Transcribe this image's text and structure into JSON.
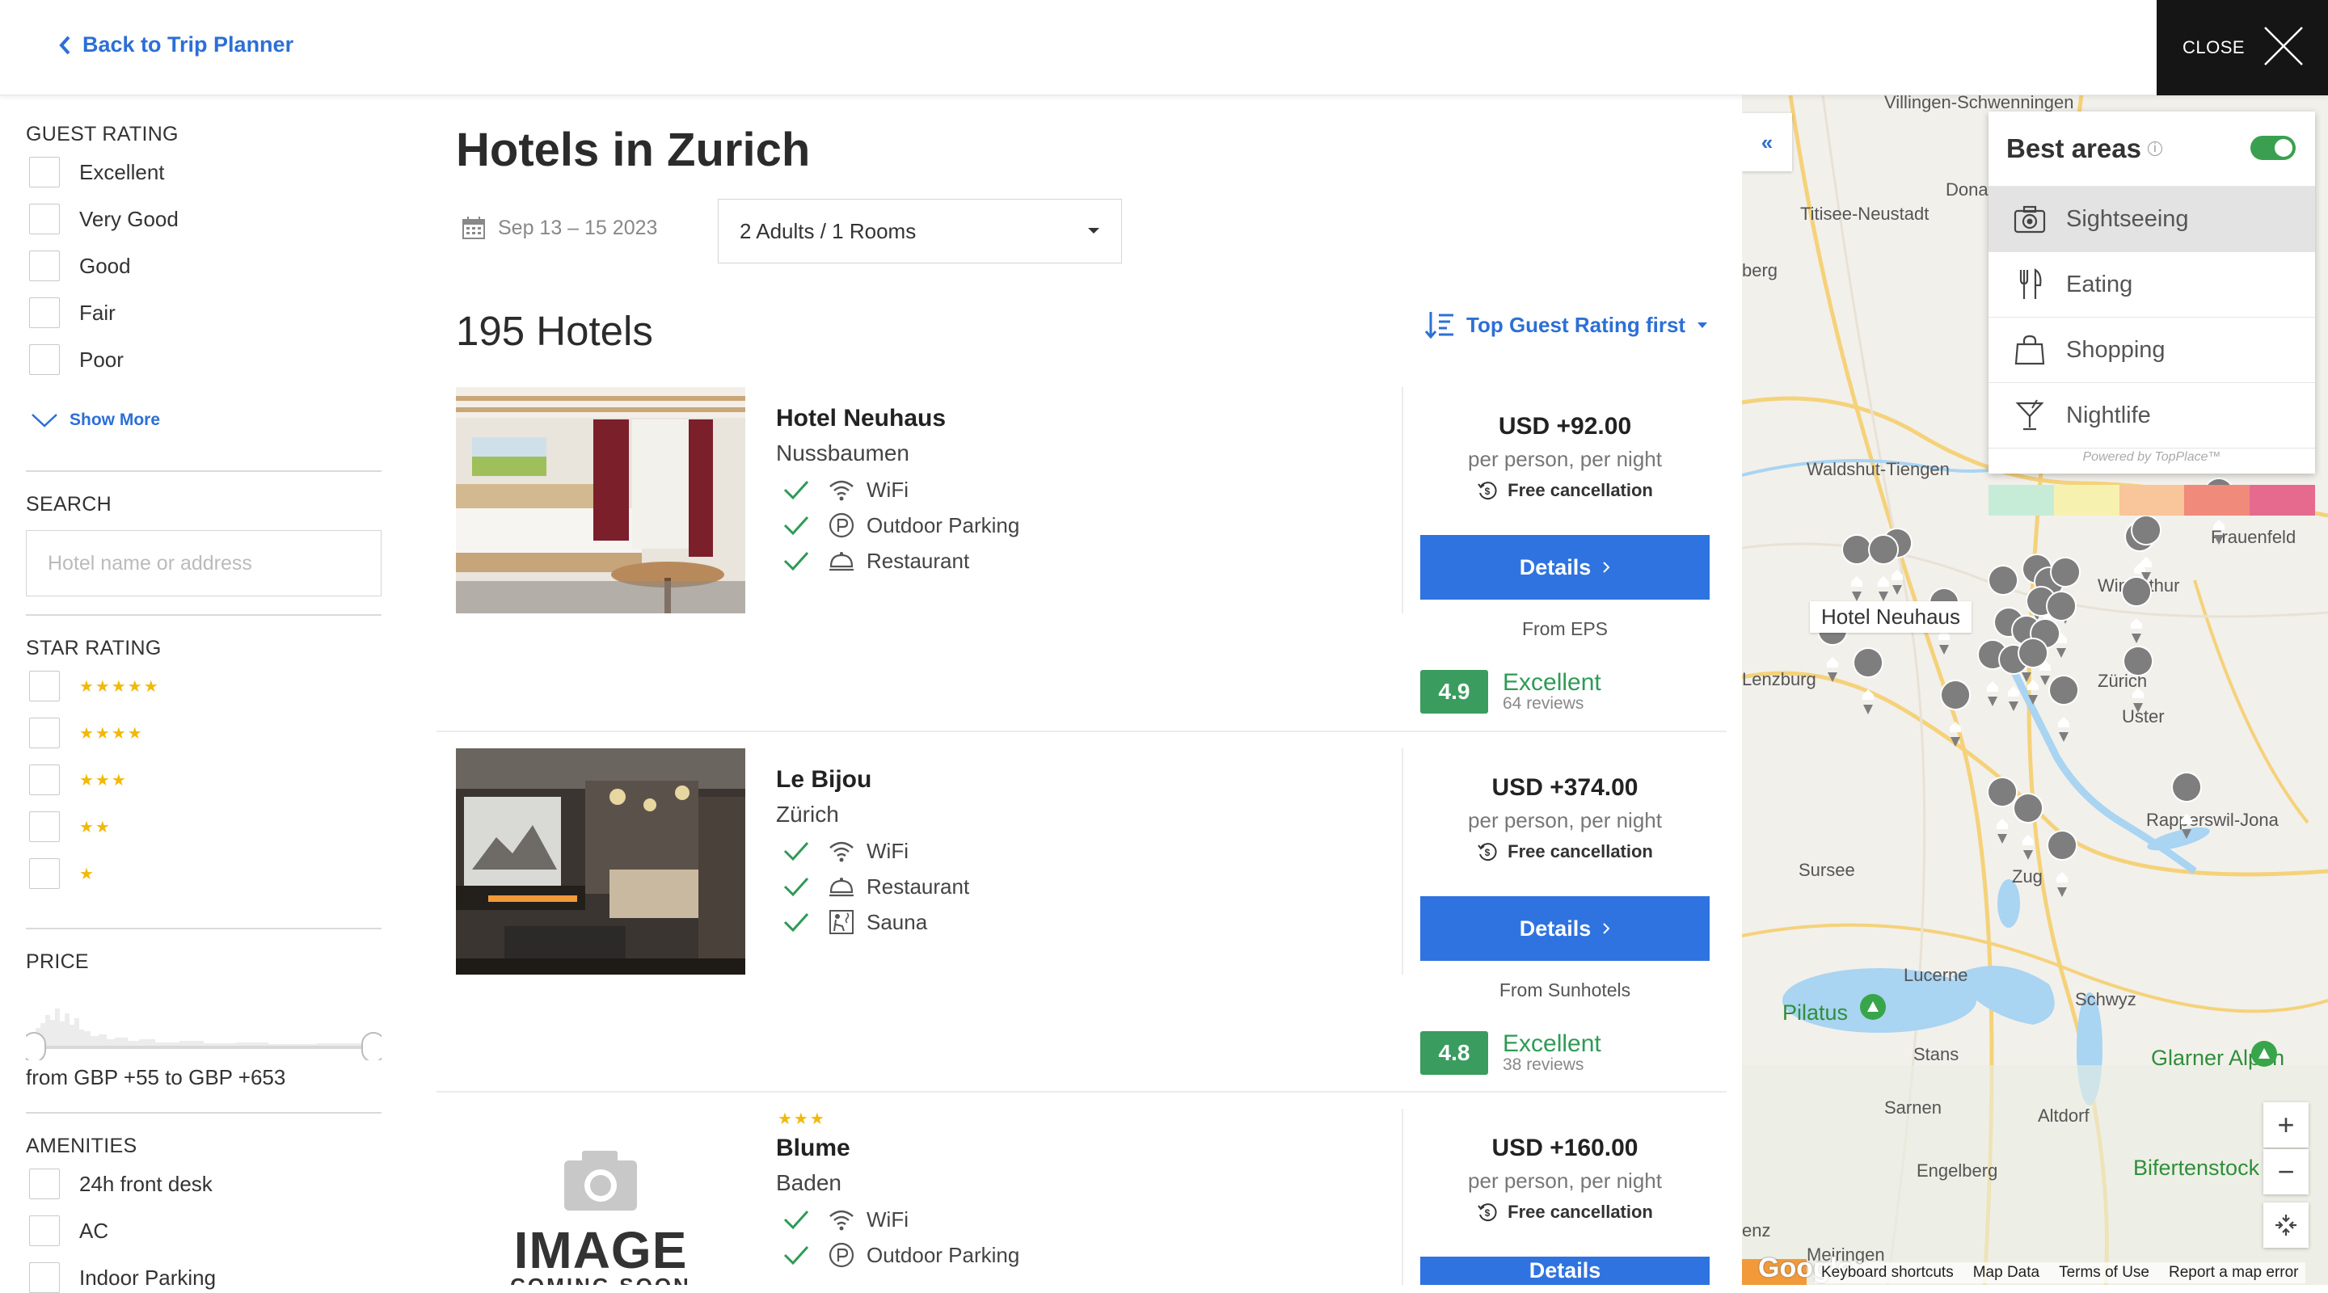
{
  "topbar": {
    "back_label": "Back to Trip Planner",
    "close_label": "CLOSE"
  },
  "filters": {
    "guest_rating": {
      "title": "GUEST RATING",
      "options": [
        "Excellent",
        "Very Good",
        "Good",
        "Fair",
        "Poor"
      ],
      "show_more": "Show More"
    },
    "search": {
      "title": "SEARCH",
      "placeholder": "Hotel name or address"
    },
    "star_rating": {
      "title": "STAR RATING",
      "options": [
        "★★★★★",
        "★★★★",
        "★★★",
        "★★",
        "★"
      ]
    },
    "price": {
      "title": "PRICE",
      "range_text": "from GBP +55 to GBP +653"
    },
    "amenities": {
      "title": "AMENITIES",
      "options": [
        "24h front desk",
        "AC",
        "Indoor Parking"
      ]
    }
  },
  "main": {
    "title": "Hotels in Zurich",
    "dates": "Sep 13 – 15 2023",
    "guests": "2 Adults / 1 Rooms",
    "count": "195 Hotels",
    "sort_label": "Top Guest Rating first"
  },
  "hotels": [
    {
      "name": "Hotel Neuhaus",
      "city": "Nussbaumen",
      "amenities": [
        "WiFi",
        "Outdoor Parking",
        "Restaurant"
      ],
      "price": "USD +92.00",
      "per": "per person, per night",
      "cancel": "Free cancellation",
      "details": "Details",
      "from": "From EPS",
      "score": "4.9",
      "score_word": "Excellent",
      "reviews": "64 reviews"
    },
    {
      "name": "Le Bijou",
      "city": "Zürich",
      "amenities": [
        "WiFi",
        "Restaurant",
        "Sauna"
      ],
      "price": "USD +374.00",
      "per": "per person, per night",
      "cancel": "Free cancellation",
      "details": "Details",
      "from": "From Sunhotels",
      "score": "4.8",
      "score_word": "Excellent",
      "reviews": "38 reviews"
    },
    {
      "name": "Blume",
      "city": "Baden",
      "stars": "★★★",
      "amenities": [
        "WiFi",
        "Outdoor Parking"
      ],
      "price": "USD +160.00",
      "per": "per person, per night",
      "cancel": "Free cancellation",
      "details": "Details",
      "image_placeholder": "IMAGE",
      "image_placeholder_sub": "COMING SOON"
    }
  ],
  "map": {
    "collapse": "«",
    "best_areas": {
      "title": "Best areas",
      "info": "i",
      "enabled": true,
      "items": [
        "Sightseeing",
        "Eating",
        "Shopping",
        "Nightlife"
      ],
      "active": "Sightseeing",
      "powered": "Powered by TopPlace™",
      "scale_colors": [
        "#c6ecd8",
        "#f7f1b0",
        "#f9c59a",
        "#f08a7a",
        "#e56a8e"
      ]
    },
    "hotel_tag": "Hotel Neuhaus",
    "zoom_in": "+",
    "zoom_out": "−",
    "footer": [
      "Keyboard shortcuts",
      "Map Data",
      "Terms of Use",
      "Report a map error"
    ],
    "google": "Google",
    "places": [
      "Villingen-Schwenningen",
      "Donau",
      "Titisee-Neustadt",
      "berg",
      "Waldshut-Tiengen",
      "Winterthur",
      "Frauenfeld",
      "Lenzburg",
      "Zürich",
      "Uster",
      "Rapperswil-Jona",
      "Sursee",
      "Zug",
      "Lucerne",
      "Pilatus",
      "Schwyz",
      "Stans",
      "Glarner Alpen",
      "Sarnen",
      "Altdorf",
      "Bifertenstock",
      "Engelberg",
      "Meiringen",
      "enz"
    ]
  },
  "colors": {
    "accent": "#2c6fd6",
    "button": "#2f73e0",
    "rating": "#3b9c5f",
    "check": "#2e9a55",
    "star": "#f2b90b"
  }
}
